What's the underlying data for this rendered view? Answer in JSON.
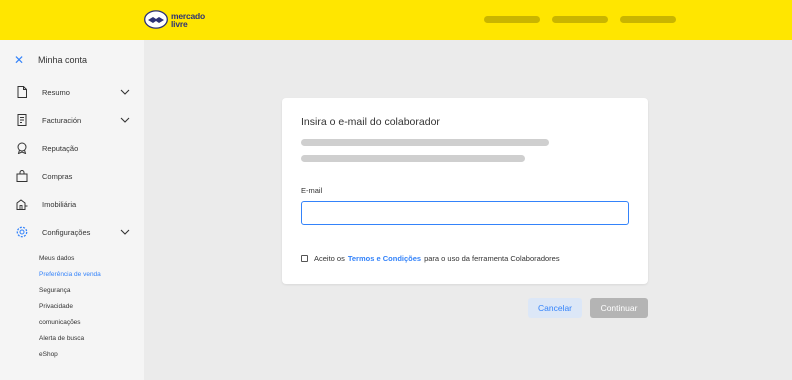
{
  "brand": {
    "line1": "mercado",
    "line2": "livre",
    "color": "#ffe600"
  },
  "sidebar": {
    "title": "Minha conta",
    "items": [
      {
        "label": "Resumo",
        "icon": "document-icon",
        "expandable": true
      },
      {
        "label": "Facturación",
        "icon": "receipt-icon",
        "expandable": true
      },
      {
        "label": "Reputação",
        "icon": "badge-icon",
        "expandable": false
      },
      {
        "label": "Compras",
        "icon": "bag-icon",
        "expandable": false
      },
      {
        "label": "Imobiliária",
        "icon": "building-icon",
        "expandable": false
      },
      {
        "label": "Configurações",
        "icon": "gear-icon",
        "expandable": true,
        "active": true
      }
    ],
    "subitems": [
      {
        "label": "Meus dados"
      },
      {
        "label": "Preferência de venda",
        "active": true
      },
      {
        "label": "Segurança"
      },
      {
        "label": "Privacidade"
      },
      {
        "label": "comunicações"
      },
      {
        "label": "Alerta de busca"
      },
      {
        "label": "eShop"
      }
    ]
  },
  "dialog": {
    "title": "Insira o e-mail do colaborador",
    "email_label": "E-mail",
    "email_value": "",
    "terms_prefix": "Aceito os",
    "terms_link": "Termos e Condições",
    "terms_suffix": "para o uso da ferramenta Colaboradores",
    "terms_checked": false
  },
  "actions": {
    "cancel": "Cancelar",
    "continue": "Continuar"
  },
  "colors": {
    "accent": "#3483fa",
    "brand_yellow": "#ffe600",
    "disabled": "#b4b4b4"
  }
}
